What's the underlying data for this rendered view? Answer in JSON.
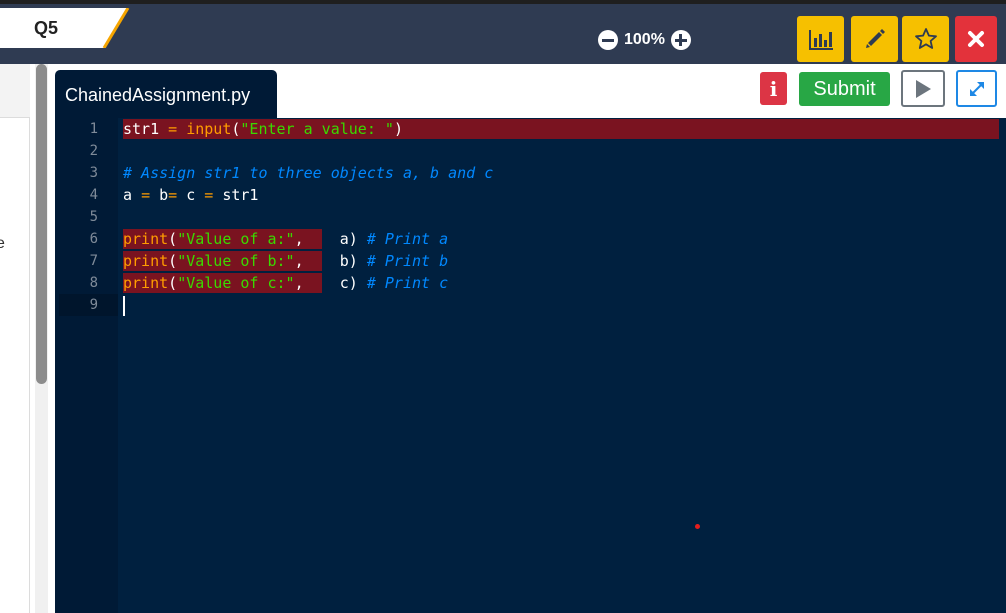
{
  "header": {
    "question_label": "Q5",
    "zoom_level": "100%"
  },
  "editor": {
    "file_name": "ChainedAssignment.py",
    "submit_label": "Submit",
    "info_label": "i",
    "line_numbers": [
      "1",
      "2",
      "3",
      "4",
      "5",
      "6",
      "7",
      "8",
      "9"
    ],
    "lines": {
      "l1": {
        "a": "str1",
        "b": " = ",
        "c": "input",
        "d": "(",
        "e": "\"Enter a value: \"",
        "f": ")"
      },
      "l3": {
        "a": "# Assign str1 to three objects a, b and c"
      },
      "l4": {
        "a": "a ",
        "b": "=",
        "c": " b",
        "d": "=",
        "e": " c ",
        "f": "=",
        "g": " str1"
      },
      "l6": {
        "a": "print",
        "b": "(",
        "c": "\"Value of a:\"",
        "d": ",    a) ",
        "e": "# Print a"
      },
      "l7": {
        "a": "print",
        "b": "(",
        "c": "\"Value of b:\"",
        "d": ",    b) ",
        "e": "# Print b"
      },
      "l8": {
        "a": "print",
        "b": "(",
        "c": "\"Value of c:\"",
        "d": ",    c) ",
        "e": "# Print c"
      }
    }
  },
  "left_panel": {
    "chevron": "‹",
    "clipped_text": "e"
  },
  "colors": {
    "topbar": "#2f3b52",
    "editor_bg": "#00203f",
    "accent_yellow": "#f6c000",
    "close_red": "#e3323b",
    "submit_green": "#28a745",
    "error_highlight": "#7a1320"
  },
  "icons": {
    "toolbar": [
      "bar-chart-icon",
      "pencil-icon",
      "star-icon",
      "close-icon"
    ],
    "zoom": [
      "zoom-out-icon",
      "zoom-in-icon"
    ],
    "editor": [
      "info-icon",
      "play-icon",
      "expand-icon"
    ]
  }
}
